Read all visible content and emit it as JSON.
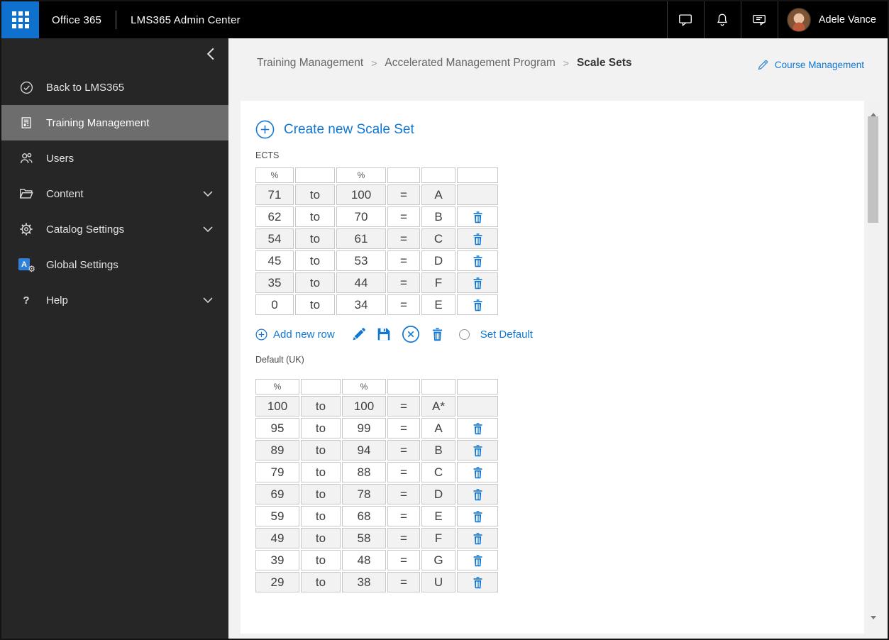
{
  "topbar": {
    "brand": "Office 365",
    "app_title": "LMS365 Admin Center",
    "user_name": "Adele Vance",
    "icons": [
      "app-launcher",
      "chat",
      "notifications",
      "feedback",
      "avatar"
    ]
  },
  "sidebar": {
    "items": [
      {
        "label": "Back to LMS365",
        "icon": "check-circle",
        "selected": false,
        "expandable": false
      },
      {
        "label": "Training Management",
        "icon": "document-list",
        "selected": true,
        "expandable": false
      },
      {
        "label": "Users",
        "icon": "people",
        "selected": false,
        "expandable": false
      },
      {
        "label": "Content",
        "icon": "folder",
        "selected": false,
        "expandable": true
      },
      {
        "label": "Catalog Settings",
        "icon": "gear",
        "selected": false,
        "expandable": true
      },
      {
        "label": "Global Settings",
        "icon": "app-a-gear",
        "selected": false,
        "expandable": false
      },
      {
        "label": "Help",
        "icon": "question-mark",
        "selected": false,
        "expandable": true
      }
    ]
  },
  "breadcrumb": {
    "separator": ">",
    "items": [
      "Training Management",
      "Accelerated Management Program",
      "Scale Sets"
    ]
  },
  "actions": {
    "course_management": "Course Management"
  },
  "main": {
    "create_label": "Create new Scale Set",
    "labels": {
      "percent": "%",
      "to": "to",
      "equals": "=",
      "add_row": "Add new row",
      "set_default": "Set Default"
    },
    "scale_sets": [
      {
        "name": "ECTS",
        "rows": [
          {
            "from": 71,
            "to": 100,
            "grade": "A"
          },
          {
            "from": 62,
            "to": 70,
            "grade": "B"
          },
          {
            "from": 54,
            "to": 61,
            "grade": "C"
          },
          {
            "from": 45,
            "to": 53,
            "grade": "D"
          },
          {
            "from": 35,
            "to": 44,
            "grade": "F"
          },
          {
            "from": 0,
            "to": 34,
            "grade": "E"
          }
        ]
      },
      {
        "name": "Default (UK)",
        "rows": [
          {
            "from": 100,
            "to": 100,
            "grade": "A*"
          },
          {
            "from": 95,
            "to": 99,
            "grade": "A"
          },
          {
            "from": 89,
            "to": 94,
            "grade": "B"
          },
          {
            "from": 79,
            "to": 88,
            "grade": "C"
          },
          {
            "from": 69,
            "to": 78,
            "grade": "D"
          },
          {
            "from": 59,
            "to": 68,
            "grade": "E"
          },
          {
            "from": 49,
            "to": 58,
            "grade": "F"
          },
          {
            "from": 39,
            "to": 48,
            "grade": "G"
          },
          {
            "from": 29,
            "to": 38,
            "grade": "U"
          }
        ]
      }
    ]
  },
  "colors": {
    "accent": "#1177d2",
    "topbar_bg": "#000000",
    "app_launcher_bg": "#1070ce",
    "sidebar_bg": "#262626",
    "sidebar_selected_bg": "#6d6d6d",
    "page_bg": "#f2f2f2",
    "card_bg": "#ffffff",
    "table_stripe": "#f2f2f2",
    "table_border": "#c7c7c7",
    "breadcrumb_current": "#333333"
  }
}
